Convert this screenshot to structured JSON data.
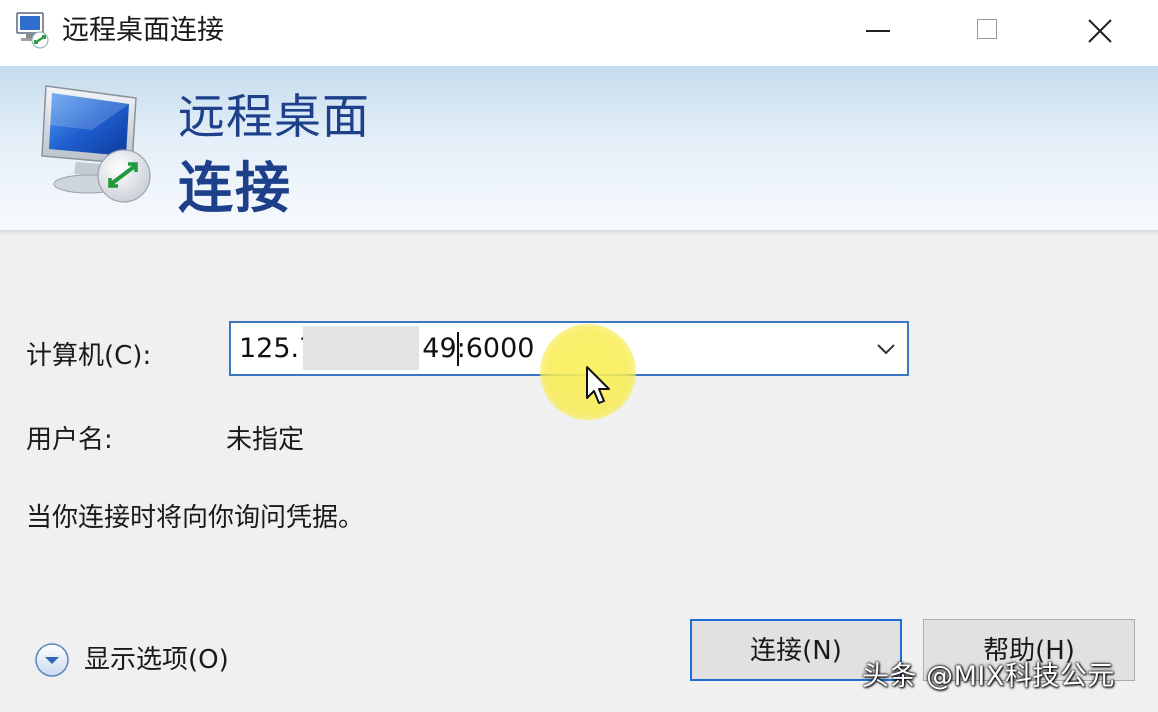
{
  "window": {
    "title": "远程桌面连接",
    "controls": {
      "minimize_icon": "minimize-icon",
      "maximize_icon": "maximize-icon",
      "close_icon": "close-icon"
    }
  },
  "header": {
    "line1": "远程桌面",
    "line2": "连接"
  },
  "form": {
    "computer_label": "计算机(C):",
    "computer_value_start": "125.7",
    "computer_value_end": "49:6000",
    "user_label": "用户名:",
    "user_value": "未指定",
    "note": "当你连接时将向你询问凭据。"
  },
  "footer": {
    "options_label": "显示选项(O)",
    "connect_label": "连接(N)",
    "help_label": "帮助(H)"
  },
  "watermark": "头条 @MIX科技公元",
  "colors": {
    "accent": "#1e6ed6",
    "header_text": "#1e3f8a",
    "focus_border": "#3c78c2",
    "cursor_highlight": "#f8ec50"
  }
}
